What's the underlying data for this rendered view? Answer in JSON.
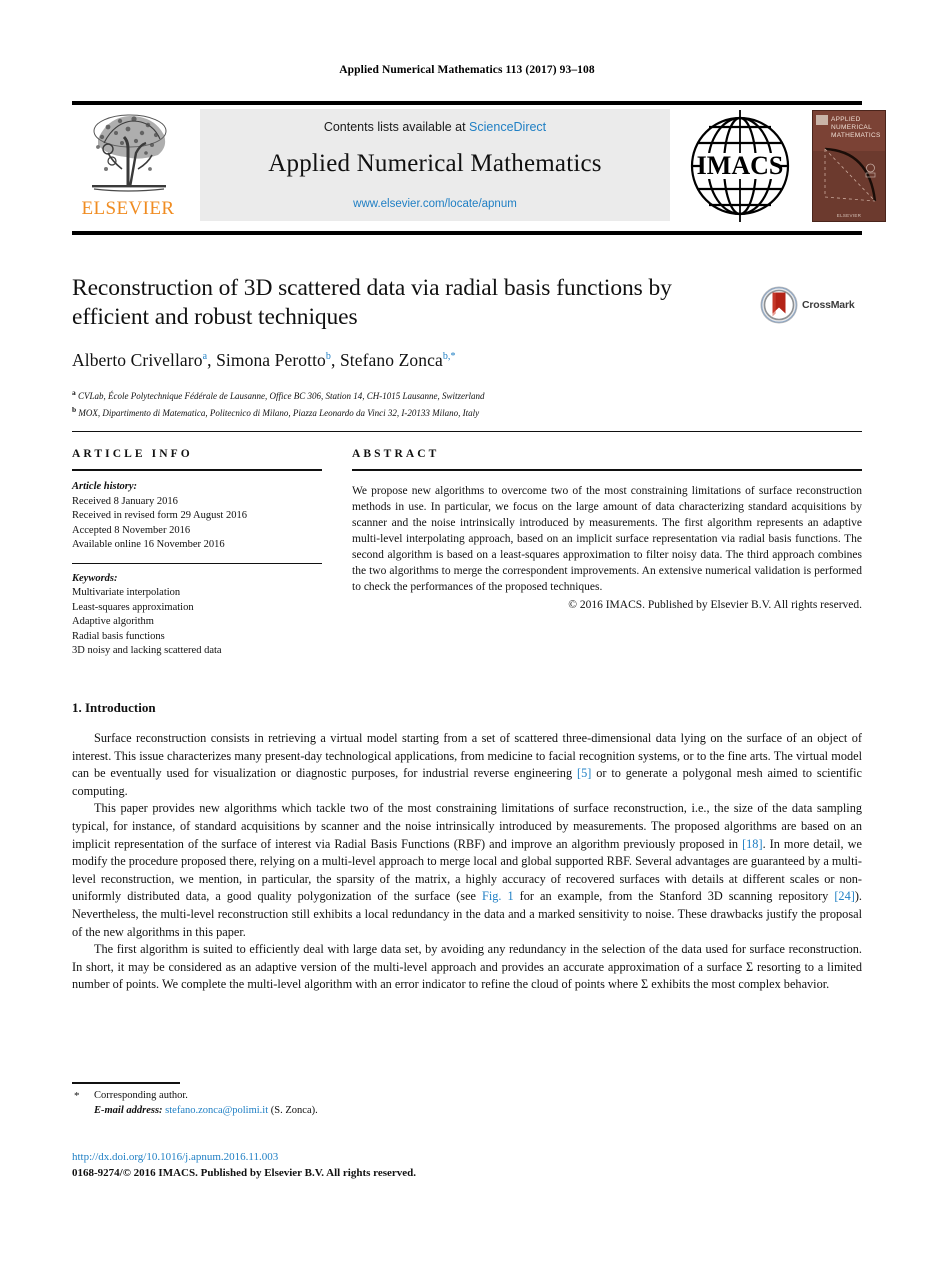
{
  "running_head": "Applied Numerical Mathematics 113 (2017) 93–108",
  "masthead": {
    "contents_prefix": "Contents lists available at ",
    "contents_link": "ScienceDirect",
    "journal_name": "Applied Numerical Mathematics",
    "journal_url": "www.elsevier.com/locate/apnum",
    "publisher_wordmark": "ELSEVIER",
    "society_logo_text": "IMACS",
    "cover": {
      "line1": "APPLIED",
      "line2": "NUMERICAL",
      "line3": "MATHEMATICS",
      "footer": "ELSEVIER"
    }
  },
  "crossmark": {
    "label": "CrossMark"
  },
  "title": "Reconstruction of 3D scattered data via radial basis functions by efficient and robust techniques",
  "authors": [
    {
      "name": "Alberto Crivellaro",
      "marks": "a",
      "sep": ", "
    },
    {
      "name": "Simona Perotto",
      "marks": "b",
      "sep": ", "
    },
    {
      "name": "Stefano Zonca",
      "marks": "b,*",
      "sep": ""
    }
  ],
  "affiliations": [
    {
      "mark": "a",
      "text": "CVLab, École Polytechnique Fédérale de Lausanne, Office BC 306, Station 14, CH-1015 Lausanne, Switzerland"
    },
    {
      "mark": "b",
      "text": "MOX, Dipartimento di Matematica, Politecnico di Milano, Piazza Leonardo da Vinci 32, I-20133 Milano, Italy"
    }
  ],
  "article_info": {
    "heading": "ARTICLE INFO",
    "history_label": "Article history:",
    "history": [
      "Received 8 January 2016",
      "Received in revised form 29 August 2016",
      "Accepted 8 November 2016",
      "Available online 16 November 2016"
    ],
    "keywords_label": "Keywords:",
    "keywords": [
      "Multivariate interpolation",
      "Least-squares approximation",
      "Adaptive algorithm",
      "Radial basis functions",
      "3D noisy and lacking scattered data"
    ]
  },
  "abstract": {
    "heading": "ABSTRACT",
    "text": "We propose new algorithms to overcome two of the most constraining limitations of surface reconstruction methods in use. In particular, we focus on the large amount of data characterizing standard acquisitions by scanner and the noise intrinsically introduced by measurements. The first algorithm represents an adaptive multi-level interpolating approach, based on an implicit surface representation via radial basis functions. The second algorithm is based on a least-squares approximation to filter noisy data. The third approach combines the two algorithms to merge the correspondent improvements. An extensive numerical validation is performed to check the performances of the proposed techniques.",
    "copyright": "© 2016 IMACS. Published by Elsevier B.V. All rights reserved."
  },
  "section": {
    "number_title": "1. Introduction",
    "paragraphs": [
      {
        "parts": [
          {
            "t": "Surface reconstruction consists in retrieving a virtual model starting from a set of scattered three-dimensional data lying on the surface of an object of interest. This issue characterizes many present-day technological applications, from medicine to facial recognition systems, or to the fine arts. The virtual model can be eventually used for visualization or diagnostic purposes, for industrial reverse engineering "
          },
          {
            "t": "[5]",
            "ref": true
          },
          {
            "t": " or to generate a polygonal mesh aimed to scientific computing."
          }
        ]
      },
      {
        "parts": [
          {
            "t": "This paper provides new algorithms which tackle two of the most constraining limitations of surface reconstruction, i.e., the size of the data sampling typical, for instance, of standard acquisitions by scanner and the noise intrinsically introduced by measurements. The proposed algorithms are based on an implicit representation of the surface of interest via Radial Basis Functions (RBF) and improve an algorithm previously proposed in "
          },
          {
            "t": "[18]",
            "ref": true
          },
          {
            "t": ". In more detail, we modify the procedure proposed there, relying on a multi-level approach to merge local and global supported RBF. Several advantages are guaranteed by a multi-level reconstruction, we mention, in particular, the sparsity of the matrix, a highly accuracy of recovered surfaces with details at different scales or non-uniformly distributed data, a good quality polygonization of the surface (see "
          },
          {
            "t": "Fig. 1",
            "ref": true
          },
          {
            "t": " for an example, from the Stanford 3D scanning repository "
          },
          {
            "t": "[24]",
            "ref": true
          },
          {
            "t": "). Nevertheless, the multi-level reconstruction still exhibits a local redundancy in the data and a marked sensitivity to noise. These drawbacks justify the proposal of the new algorithms in this paper."
          }
        ]
      },
      {
        "parts": [
          {
            "t": "The first algorithm is suited to efficiently deal with large data set, by avoiding any redundancy in the selection of the data used for surface reconstruction. In short, it may be considered as an adaptive version of the multi-level approach and provides an accurate approximation of a surface Σ resorting to a limited number of points. We complete the multi-level algorithm with an error indicator to refine the cloud of points where Σ exhibits the most complex behavior."
          }
        ]
      }
    ]
  },
  "footnote": {
    "corresponding": "Corresponding author.",
    "email_label": "E-mail address:",
    "email": "stefano.zonca@polimi.it",
    "email_suffix": "(S. Zonca)."
  },
  "colophon": {
    "doi": "http://dx.doi.org/10.1016/j.apnum.2016.11.003",
    "issn_line": "0168-9274/© 2016 IMACS. Published by Elsevier B.V. All rights reserved."
  },
  "colors": {
    "link": "#1F7FC4",
    "elsevier_orange": "#F08C21",
    "cover_brown": "#6C3A2E",
    "band_gray": "#EBEBEB"
  }
}
